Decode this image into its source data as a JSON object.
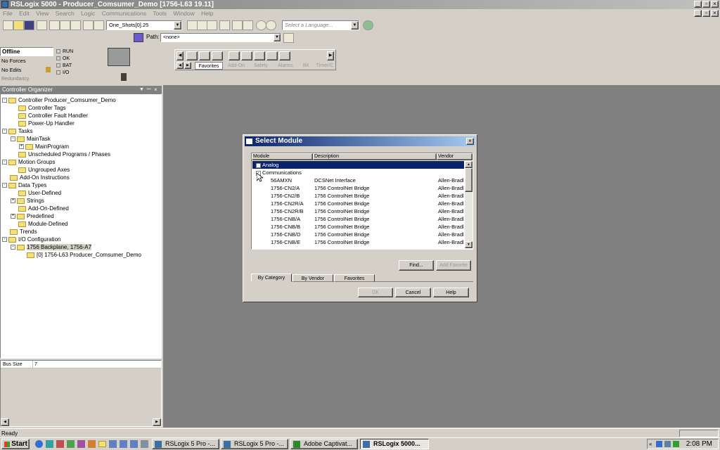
{
  "window": {
    "title": "RSLogix 5000 - Producer_Comsumer_Demo [1756-L63 19.11]"
  },
  "menu": [
    "File",
    "Edit",
    "View",
    "Search",
    "Logic",
    "Communications",
    "Tools",
    "Window",
    "Help"
  ],
  "toolbar": {
    "tag_combo": "One_Shots[0].25",
    "language_placeholder": "Select a Language...",
    "path_label": "Path:",
    "path_value": "<none>"
  },
  "status_panel": {
    "mode": "Offline",
    "forces": "No Forces",
    "edits": "No Edits",
    "redundancy": "Redundancy",
    "indicators": [
      "RUN",
      "OK",
      "BAT",
      "I/O"
    ]
  },
  "instruction_tabs": [
    "Favorites",
    "Add-On",
    "Safety",
    "Alarms",
    "Bit",
    "Timer/C"
  ],
  "organizer": {
    "title": "Controller Organizer",
    "tree": [
      {
        "label": "Controller Producer_Comsumer_Demo",
        "level": 0,
        "exp": "-"
      },
      {
        "label": "Controller Tags",
        "level": 1,
        "exp": ""
      },
      {
        "label": "Controller Fault Handler",
        "level": 1,
        "exp": ""
      },
      {
        "label": "Power-Up Handler",
        "level": 1,
        "exp": ""
      },
      {
        "label": "Tasks",
        "level": 0,
        "exp": "-"
      },
      {
        "label": "MainTask",
        "level": 1,
        "exp": "-"
      },
      {
        "label": "MainProgram",
        "level": 2,
        "exp": "+"
      },
      {
        "label": "Unscheduled Programs / Phases",
        "level": 1,
        "exp": ""
      },
      {
        "label": "Motion Groups",
        "level": 0,
        "exp": "-"
      },
      {
        "label": "Ungrouped Axes",
        "level": 1,
        "exp": ""
      },
      {
        "label": "Add-On Instructions",
        "level": 0,
        "exp": ""
      },
      {
        "label": "Data Types",
        "level": 0,
        "exp": "-"
      },
      {
        "label": "User-Defined",
        "level": 1,
        "exp": ""
      },
      {
        "label": "Strings",
        "level": 1,
        "exp": "+"
      },
      {
        "label": "Add-On-Defined",
        "level": 1,
        "exp": ""
      },
      {
        "label": "Predefined",
        "level": 1,
        "exp": "+"
      },
      {
        "label": "Module-Defined",
        "level": 1,
        "exp": ""
      },
      {
        "label": "Trends",
        "level": 0,
        "exp": ""
      },
      {
        "label": "I/O Configuration",
        "level": 0,
        "exp": "-"
      },
      {
        "label": "1756 Backplane, 1756-A7",
        "level": 1,
        "exp": "-"
      },
      {
        "label": "[0] 1756-L63 Producer_Comsumer_Demo",
        "level": 2,
        "exp": ""
      }
    ],
    "props": {
      "name": "Bus Size",
      "value": "7"
    }
  },
  "dialog": {
    "title": "Select Module",
    "columns": [
      "Module",
      "Description",
      "Vendor"
    ],
    "rows": [
      {
        "module": "Analog",
        "description": "",
        "vendor": "",
        "group": true,
        "exp": "+",
        "selected": true
      },
      {
        "module": "Communications",
        "description": "",
        "vendor": "",
        "group": true,
        "exp": "-",
        "selected": false
      },
      {
        "module": "56AMXN",
        "description": "DCSNet Interface",
        "vendor": "Allen-Bradl",
        "group": false
      },
      {
        "module": "1756-CN2/A",
        "description": "1756 ControlNet Bridge",
        "vendor": "Allen-Bradl",
        "group": false
      },
      {
        "module": "1756-CN2/B",
        "description": "1756 ControlNet Bridge",
        "vendor": "Allen-Bradl",
        "group": false
      },
      {
        "module": "1756-CN2R/A",
        "description": "1756 ControlNet Bridge",
        "vendor": "Allen-Bradl",
        "group": false
      },
      {
        "module": "1756-CN2R/B",
        "description": "1756 ControlNet Bridge",
        "vendor": "Allen-Bradl",
        "group": false
      },
      {
        "module": "1756-CNB/A",
        "description": "1756 ControlNet Bridge",
        "vendor": "Allen-Bradl",
        "group": false
      },
      {
        "module": "1756-CNB/B",
        "description": "1756 ControlNet Bridge",
        "vendor": "Allen-Bradl",
        "group": false
      },
      {
        "module": "1756-CNB/D",
        "description": "1756 ControlNet Bridge",
        "vendor": "Allen-Bradl",
        "group": false
      },
      {
        "module": "1756-CNB/E",
        "description": "1756 ControlNet Bridge",
        "vendor": "Allen-Bradl",
        "group": false
      }
    ],
    "find_label": "Find...",
    "add_favorite_label": "Add Favorite",
    "tabs": [
      "By Category",
      "By Vendor",
      "Favorites"
    ],
    "ok_label": "OK",
    "cancel_label": "Cancel",
    "help_label": "Help"
  },
  "statusbar": {
    "text": "Ready"
  },
  "taskbar": {
    "start": "Start",
    "buttons": [
      "RSLogix 5 Pro -...",
      "RSLogix 5 Pro -...",
      "Adobe Captivat...",
      "RSLogix 5000..."
    ],
    "clock": "2:08 PM"
  },
  "colors": {
    "title_active": "#0a246a",
    "title_gradient": "#a6caf0",
    "workspace": "#808080",
    "selection": "#0a246a"
  }
}
